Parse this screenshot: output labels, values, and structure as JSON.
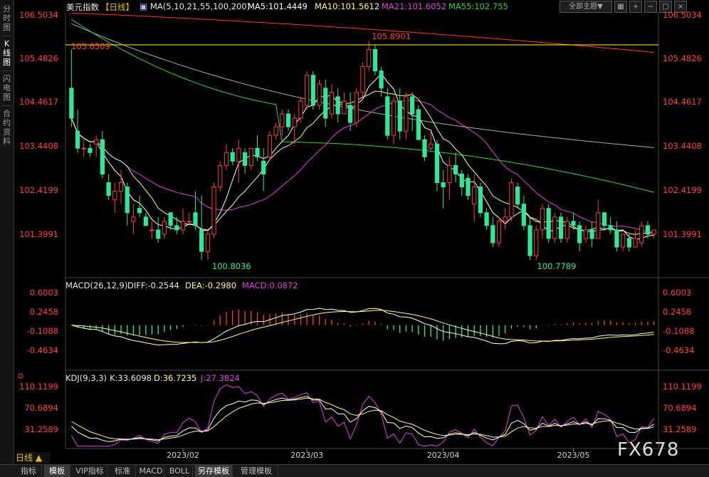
{
  "left_tabs": [
    "分时图",
    "K线图",
    "闪电图",
    "合约资料"
  ],
  "header": {
    "symbol": "美元指数",
    "period_tag": "【日线】",
    "ma_label": "MA(5,10,21,55,100,200)",
    "ma5": "MA5:101.4449",
    "ma10": "MA10:101.5612",
    "ma21": "MA21:101.6052",
    "ma55": "MA55:102.755",
    "theme_button": "全部主题▼",
    "tool_icons": [
      "grid-icon",
      "plus-icon",
      "minus-icon",
      "restore-icon",
      "close-icon"
    ]
  },
  "colors": {
    "up": "#ff3b3b",
    "down": "#2ee89a",
    "ma5": "#ffffff",
    "ma10": "#ffff66",
    "ma21": "#e040e0",
    "ma55": "#30d030",
    "ma100": "#aaaaaa",
    "ma200": "#ff3030",
    "hline": "#ffff00"
  },
  "main_panel": {
    "y_ticks": [
      "106.5034",
      "105.4826",
      "104.4617",
      "103.4408",
      "102.4199",
      "101.3991"
    ],
    "annotations": {
      "hline_label": "105.6509",
      "high": "105.8901",
      "low_feb": "100.8036",
      "low_apr": "100.7789"
    }
  },
  "macd_panel": {
    "title": "MACD(26,12,9)",
    "diff": "DIFF:-0.2544",
    "dea": "DEA:-0.2980",
    "macd": "MACD:0.0872",
    "y_ticks": [
      "0.6003",
      "0.2458",
      "-0.1088",
      "-0.4634"
    ]
  },
  "kdj_panel": {
    "title": "KDJ(9,3,3)",
    "k": "K:33.6098",
    "d": "D:36.7235",
    "j": "J:27.3824",
    "y_ticks": [
      "110.1199",
      "70.6894",
      "31.2589"
    ]
  },
  "x_axis": {
    "labels": [
      "2023/02",
      "2023/03",
      "2023/04",
      "2023/05"
    ]
  },
  "period_label": "日线",
  "period_arrow": "▲",
  "bottom_tabs": [
    "指标",
    "模板",
    "VIP指标",
    "标准",
    "MACD",
    "BOLL",
    "另存模板",
    "管理模板"
  ],
  "watermark": "FX678",
  "chart_data": {
    "type": "candlestick",
    "y_range": [
      100.6,
      106.7
    ],
    "candles": [
      [
        104.8,
        105.7,
        103.9,
        104.1
      ],
      [
        103.8,
        104.3,
        103.3,
        103.4
      ],
      [
        103.4,
        103.6,
        103.2,
        103.4
      ],
      [
        103.4,
        103.5,
        103.2,
        103.3
      ],
      [
        103.5,
        103.7,
        103.2,
        103.6
      ],
      [
        103.6,
        103.8,
        102.7,
        102.8
      ],
      [
        102.6,
        102.8,
        102.2,
        102.3
      ],
      [
        102.2,
        102.6,
        101.9,
        102.4
      ],
      [
        102.4,
        102.9,
        102.1,
        102.6
      ],
      [
        102.5,
        102.6,
        101.6,
        101.9
      ],
      [
        101.7,
        102.1,
        101.4,
        101.8
      ],
      [
        102.0,
        102.3,
        101.8,
        101.9
      ],
      [
        101.8,
        101.9,
        101.6,
        101.6
      ],
      [
        101.5,
        101.7,
        101.3,
        101.5
      ],
      [
        101.5,
        101.8,
        101.2,
        101.3
      ],
      [
        101.4,
        101.8,
        101.3,
        101.7
      ],
      [
        101.9,
        101.9,
        101.5,
        101.6
      ],
      [
        101.6,
        101.8,
        101.4,
        101.5
      ],
      [
        101.5,
        102.0,
        101.4,
        101.7
      ],
      [
        101.7,
        101.9,
        101.6,
        101.7
      ],
      [
        101.9,
        102.4,
        101.5,
        101.6
      ],
      [
        101.5,
        102.3,
        100.8,
        101.0
      ],
      [
        101.0,
        101.5,
        100.8,
        101.4
      ],
      [
        101.4,
        102.6,
        101.3,
        102.5
      ],
      [
        102.5,
        103.1,
        102.4,
        103.0
      ],
      [
        103.0,
        103.5,
        102.9,
        103.3
      ],
      [
        103.3,
        103.4,
        103.0,
        103.1
      ],
      [
        103.1,
        103.6,
        102.6,
        103.4
      ],
      [
        103.3,
        103.4,
        102.8,
        103.0
      ],
      [
        103.0,
        103.4,
        102.9,
        103.4
      ],
      [
        103.4,
        103.7,
        103.1,
        103.2
      ],
      [
        103.1,
        103.4,
        102.4,
        102.8
      ],
      [
        103.2,
        103.8,
        103.1,
        103.7
      ],
      [
        103.7,
        104.0,
        103.6,
        103.9
      ],
      [
        103.9,
        104.3,
        103.7,
        104.2
      ],
      [
        104.2,
        104.3,
        103.8,
        103.9
      ],
      [
        103.9,
        104.2,
        103.5,
        104.1
      ],
      [
        104.1,
        104.6,
        104.0,
        104.5
      ],
      [
        104.4,
        105.2,
        104.3,
        105.1
      ],
      [
        105.1,
        105.2,
        104.3,
        104.4
      ],
      [
        104.4,
        105.0,
        104.3,
        104.9
      ],
      [
        104.8,
        105.0,
        103.9,
        104.1
      ],
      [
        104.2,
        104.9,
        104.1,
        104.7
      ],
      [
        104.6,
        104.8,
        104.0,
        104.2
      ],
      [
        104.2,
        104.7,
        104.2,
        104.5
      ],
      [
        104.4,
        104.7,
        103.8,
        104.0
      ],
      [
        104.0,
        104.8,
        103.9,
        104.7
      ],
      [
        104.7,
        105.4,
        104.6,
        105.3
      ],
      [
        105.3,
        105.9,
        105.2,
        105.7
      ],
      [
        105.7,
        105.8,
        105.1,
        105.2
      ],
      [
        105.2,
        105.3,
        104.6,
        104.8
      ],
      [
        104.6,
        104.8,
        103.6,
        103.7
      ],
      [
        103.7,
        104.6,
        103.5,
        104.5
      ],
      [
        104.5,
        104.8,
        103.6,
        103.8
      ],
      [
        103.8,
        104.7,
        103.6,
        104.6
      ],
      [
        104.6,
        104.7,
        103.8,
        104.2
      ],
      [
        104.3,
        104.4,
        103.6,
        103.6
      ],
      [
        103.6,
        103.7,
        103.1,
        103.2
      ],
      [
        103.4,
        103.8,
        103.3,
        103.5
      ],
      [
        103.5,
        103.6,
        102.4,
        102.6
      ],
      [
        102.6,
        102.9,
        102.0,
        102.5
      ],
      [
        102.6,
        103.2,
        102.2,
        103.0
      ],
      [
        103.0,
        103.3,
        102.6,
        102.8
      ],
      [
        102.8,
        102.9,
        102.3,
        102.5
      ],
      [
        102.7,
        102.8,
        102.2,
        102.3
      ],
      [
        102.1,
        102.8,
        101.7,
        102.5
      ],
      [
        102.5,
        102.6,
        101.8,
        101.9
      ],
      [
        101.9,
        102.0,
        101.5,
        101.6
      ],
      [
        101.6,
        101.8,
        101.1,
        101.2
      ],
      [
        101.2,
        101.8,
        101.1,
        101.7
      ],
      [
        101.7,
        102.0,
        101.5,
        101.8
      ],
      [
        101.8,
        102.7,
        101.7,
        102.6
      ],
      [
        102.5,
        102.6,
        102.0,
        102.1
      ],
      [
        102.1,
        102.3,
        101.5,
        101.6
      ],
      [
        101.6,
        101.8,
        100.8,
        100.9
      ],
      [
        100.9,
        101.6,
        100.8,
        101.5
      ],
      [
        101.5,
        102.1,
        101.3,
        102.0
      ],
      [
        102.0,
        102.1,
        101.2,
        101.3
      ],
      [
        101.3,
        101.9,
        101.2,
        101.8
      ],
      [
        101.8,
        101.9,
        101.2,
        101.3
      ],
      [
        101.3,
        101.8,
        101.2,
        101.7
      ],
      [
        101.7,
        101.9,
        101.5,
        101.6
      ],
      [
        101.6,
        101.7,
        101.0,
        101.2
      ],
      [
        101.3,
        101.6,
        101.2,
        101.5
      ],
      [
        101.5,
        101.7,
        101.1,
        101.3
      ],
      [
        101.3,
        102.2,
        101.3,
        101.9
      ],
      [
        101.9,
        101.9,
        101.5,
        101.6
      ],
      [
        101.6,
        101.8,
        101.4,
        101.5
      ],
      [
        101.5,
        101.7,
        101.0,
        101.1
      ],
      [
        101.1,
        101.4,
        101.0,
        101.4
      ],
      [
        101.3,
        101.4,
        101.0,
        101.1
      ],
      [
        101.1,
        101.5,
        101.1,
        101.3
      ],
      [
        101.2,
        101.7,
        101.1,
        101.6
      ],
      [
        101.6,
        101.7,
        101.3,
        101.4
      ],
      [
        101.4,
        101.5,
        101.3,
        101.5
      ]
    ]
  }
}
